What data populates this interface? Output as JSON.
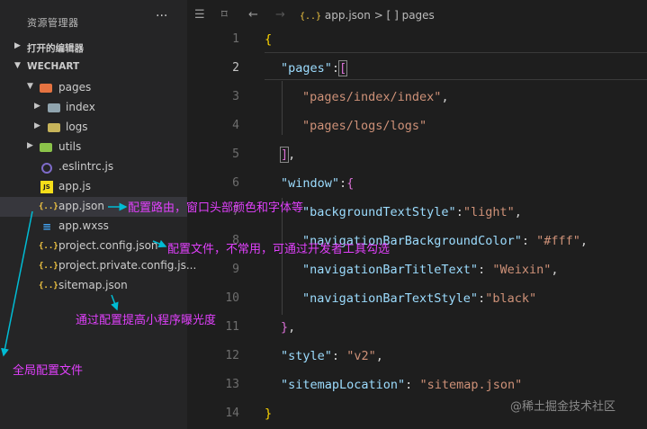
{
  "sidebar": {
    "title": "资源管理器",
    "more": "···",
    "open_editors": "打开的编辑器",
    "workspace": "WECHART",
    "items": [
      {
        "label": "pages"
      },
      {
        "label": "index"
      },
      {
        "label": "logs"
      },
      {
        "label": "utils"
      },
      {
        "label": ".eslintrc.js"
      },
      {
        "label": "app.js"
      },
      {
        "label": "app.json"
      },
      {
        "label": "app.wxss"
      },
      {
        "label": "project.config.json"
      },
      {
        "label": "project.private.config.js..."
      },
      {
        "label": "sitemap.json"
      }
    ]
  },
  "annotations": {
    "app_json": "配置路由，窗口头部颜色和字体等",
    "project_config": "配置文件，不常用，可通过开发者工具勾选",
    "sitemap": "通过配置提高小程序曝光度",
    "global": "全局配置文件"
  },
  "editor": {
    "breadcrumb_file": "app.json",
    "breadcrumb_sep": ">",
    "breadcrumb_node": "[ ] pages",
    "json_icon": "{..}",
    "line_numbers": [
      "1",
      "2",
      "3",
      "4",
      "5",
      "6",
      "7",
      "8",
      "9",
      "10",
      "11",
      "12",
      "13",
      "14"
    ]
  },
  "code": {
    "l1": "{",
    "pages_key": "\"pages\"",
    "colon": ":",
    "open_bracket": "[",
    "page1": "\"pages/index/index\"",
    "comma": ",",
    "page2": "\"pages/logs/logs\"",
    "close_bracket": "]",
    "window_key": "\"window\"",
    "open_brace": "{",
    "k_bgts": "\"backgroundTextStyle\"",
    "v_bgts": "\"light\"",
    "k_nbbc": "\"navigationBarBackgroundColor\"",
    "v_nbbc": "\"#fff\"",
    "k_nbtt": "\"navigationBarTitleText\"",
    "v_nbtt": "\"Weixin\"",
    "k_nbts": "\"navigationBarTextStyle\"",
    "v_nbts": "\"black\"",
    "close_brace": "}",
    "style_key": "\"style\"",
    "style_val": "\"v2\"",
    "sitemap_key": "\"sitemapLocation\"",
    "sitemap_val": "\"sitemap.json\"",
    "l14": "}"
  },
  "watermark": "@稀土掘金技术社区",
  "colors": {
    "annotation": "#e040fb",
    "arrow": "#00bcd4"
  }
}
